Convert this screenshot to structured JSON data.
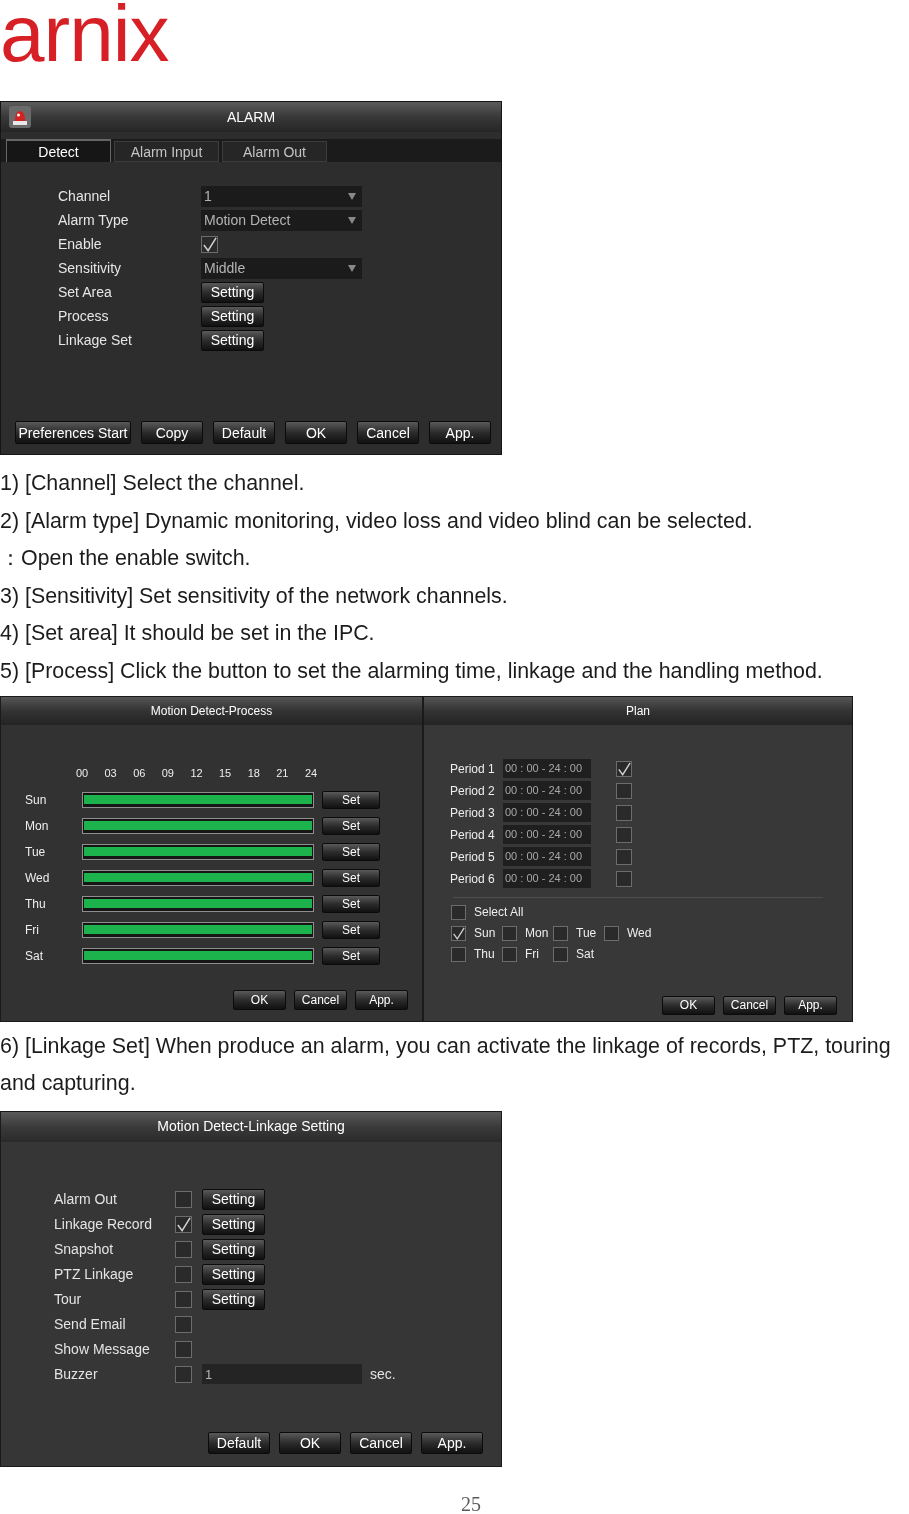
{
  "logo": {
    "text": "arnix"
  },
  "alarm_window": {
    "title": "ALARM",
    "tabs": [
      {
        "label": "Detect",
        "selected": true
      },
      {
        "label": "Alarm Input",
        "selected": false
      },
      {
        "label": "Alarm Out",
        "selected": false
      }
    ],
    "fields": [
      {
        "label": "Channel",
        "kind": "dropdown",
        "value": "1"
      },
      {
        "label": "Alarm Type",
        "kind": "dropdown",
        "value": "Motion Detect"
      },
      {
        "label": "Enable",
        "kind": "checkbox",
        "checked": true
      },
      {
        "label": "Sensitivity",
        "kind": "dropdown",
        "value": "Middle"
      },
      {
        "label": "Set Area",
        "kind": "button",
        "button": "Setting"
      },
      {
        "label": "Process",
        "kind": "button",
        "button": "Setting"
      },
      {
        "label": "Linkage Set",
        "kind": "button",
        "button": "Setting"
      }
    ],
    "buttons": [
      "Preferences Start",
      "Copy",
      "Default",
      "OK",
      "Cancel",
      "App."
    ]
  },
  "notes_1": [
    "1) [Channel] Select the channel.",
    "2) [Alarm type] Dynamic monitoring, video loss and video blind can be selected.",
    "：Open the enable switch.",
    "3) [Sensitivity] Set sensitivity of the network channels.",
    "4) [Set area] It should be set in the IPC.",
    "5) [Process] Click the button to set the alarming time, linkage and the handling method."
  ],
  "process_window": {
    "title": "Motion Detect-Process",
    "hours": [
      "00",
      "03",
      "06",
      "09",
      "12",
      "15",
      "18",
      "21",
      "24"
    ],
    "days": [
      {
        "label": "Sun",
        "level": 1,
        "button": "Set"
      },
      {
        "label": "Mon",
        "level": 1,
        "button": "Set"
      },
      {
        "label": "Tue",
        "level": 1,
        "button": "Set"
      },
      {
        "label": "Wed",
        "level": 1,
        "button": "Set"
      },
      {
        "label": "Thu",
        "level": 1,
        "button": "Set"
      },
      {
        "label": "Fri",
        "level": 1,
        "button": "Set"
      },
      {
        "label": "Sat",
        "level": 1,
        "button": "Set"
      }
    ],
    "buttons": [
      "OK",
      "Cancel",
      "App."
    ]
  },
  "plan_window": {
    "title": "Plan",
    "periods": [
      {
        "label": "Period 1",
        "value": "00 : 00 - 24 : 00",
        "checked": true
      },
      {
        "label": "Period 2",
        "value": "00 : 00 - 24 : 00",
        "checked": false
      },
      {
        "label": "Period 3",
        "value": "00 : 00 - 24 : 00",
        "checked": false
      },
      {
        "label": "Period 4",
        "value": "00 : 00 - 24 : 00",
        "checked": false
      },
      {
        "label": "Period 5",
        "value": "00 : 00 - 24 : 00",
        "checked": false
      },
      {
        "label": "Period 6",
        "value": "00 : 00 - 24 : 00",
        "checked": false
      }
    ],
    "select_all": {
      "label": "Select All",
      "checked": false
    },
    "days": [
      {
        "label": "Sun",
        "checked": true
      },
      {
        "label": "Mon",
        "checked": false
      },
      {
        "label": "Tue",
        "checked": false
      },
      {
        "label": "Wed",
        "checked": false
      },
      {
        "label": "Thu",
        "checked": false
      },
      {
        "label": "Fri",
        "checked": false
      },
      {
        "label": "Sat",
        "checked": false
      }
    ],
    "buttons": [
      "OK",
      "Cancel",
      "App."
    ]
  },
  "notes_2": [
    "6) [Linkage Set] When produce an alarm, you can activate the linkage of records, PTZ, touring and capturing."
  ],
  "linkage_window": {
    "title": "Motion Detect-Linkage Setting",
    "rows": [
      {
        "label": "Alarm Out",
        "kind": "button",
        "checked": false,
        "button": "Setting"
      },
      {
        "label": "Linkage Record",
        "kind": "button",
        "checked": true,
        "button": "Setting"
      },
      {
        "label": "Snapshot",
        "kind": "button",
        "checked": false,
        "button": "Setting"
      },
      {
        "label": "PTZ Linkage",
        "kind": "button",
        "checked": false,
        "button": "Setting"
      },
      {
        "label": "Tour",
        "kind": "button",
        "checked": false,
        "button": "Setting"
      },
      {
        "label": "Send Email",
        "kind": "plain",
        "checked": false
      },
      {
        "label": "Show Message",
        "kind": "plain",
        "checked": false
      },
      {
        "label": "Buzzer",
        "kind": "input",
        "checked": false,
        "value": "1",
        "unit": "sec."
      }
    ],
    "buttons": [
      "Default",
      "OK",
      "Cancel",
      "App."
    ]
  },
  "page_number": "25"
}
